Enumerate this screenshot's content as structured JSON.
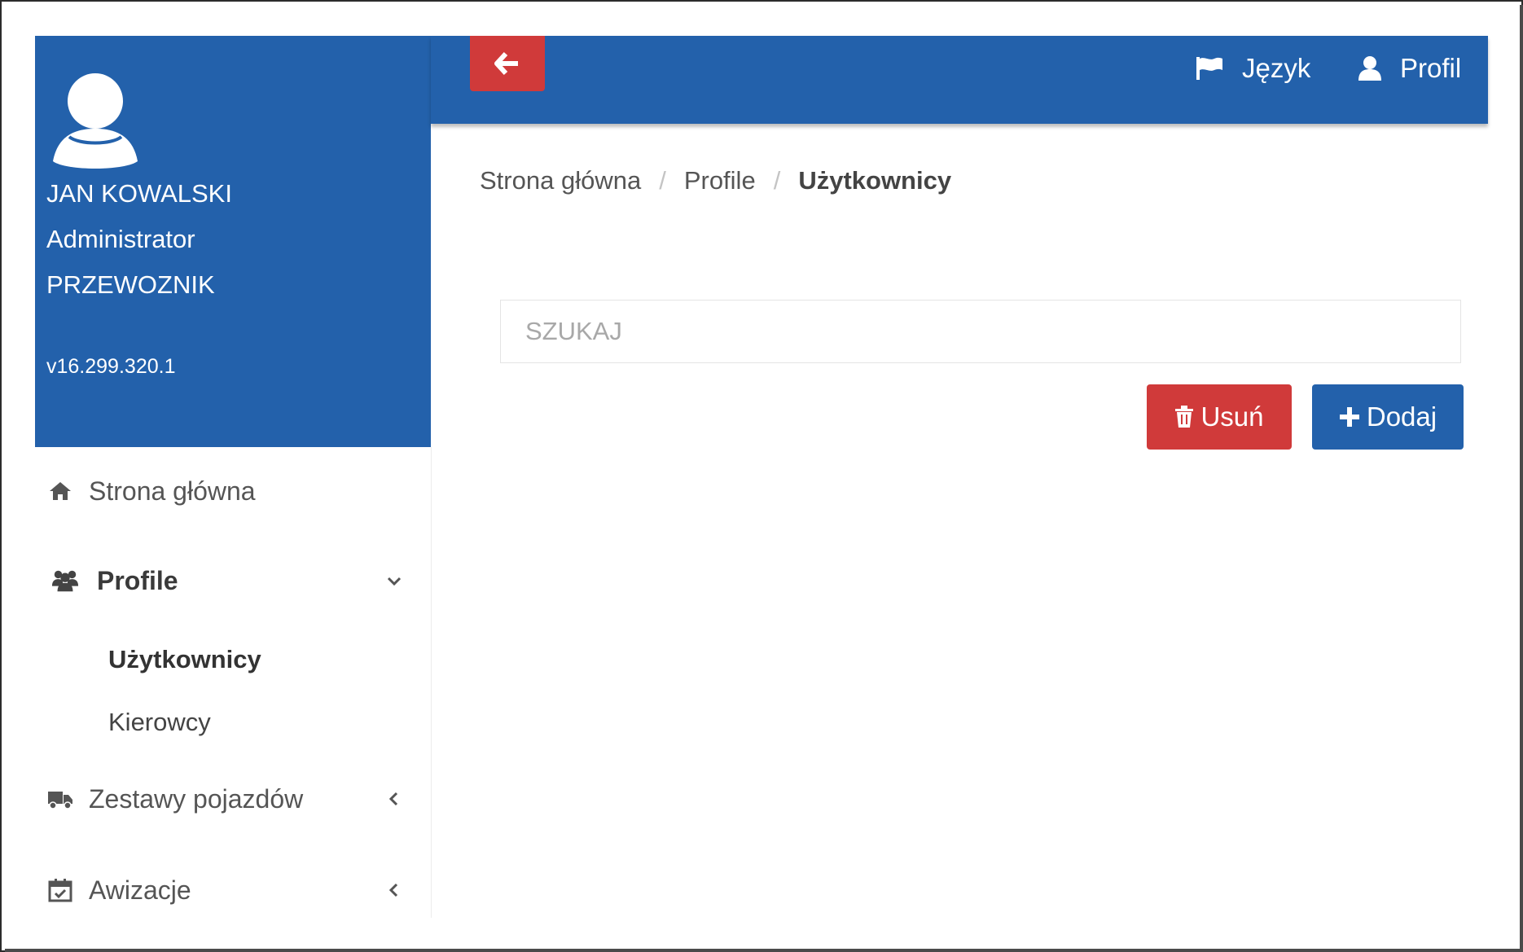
{
  "user": {
    "name": "JAN KOWALSKI",
    "role": "Administrator",
    "company": "PRZEWOZNIK",
    "version": "v16.299.320.1"
  },
  "header": {
    "language_label": "Język",
    "profile_label": "Profil"
  },
  "sidebar": {
    "items": [
      {
        "label": "Strona główna",
        "icon": "home-icon"
      },
      {
        "label": "Profile",
        "icon": "users-icon",
        "expanded": true,
        "children": [
          {
            "label": "Użytkownicy",
            "active": true
          },
          {
            "label": "Kierowcy"
          }
        ]
      },
      {
        "label": "Zestawy pojazdów",
        "icon": "truck-icon"
      },
      {
        "label": "Awizacje",
        "icon": "calendar-check-icon"
      }
    ]
  },
  "breadcrumb": {
    "items": [
      "Strona główna",
      "Profile"
    ],
    "current": "Użytkownicy",
    "separator": "/"
  },
  "search": {
    "placeholder": "SZUKAJ",
    "value": ""
  },
  "actions": {
    "delete_label": "Usuń",
    "add_label": "Dodaj"
  },
  "colors": {
    "primary": "#2361ab",
    "danger": "#d03a3a"
  }
}
